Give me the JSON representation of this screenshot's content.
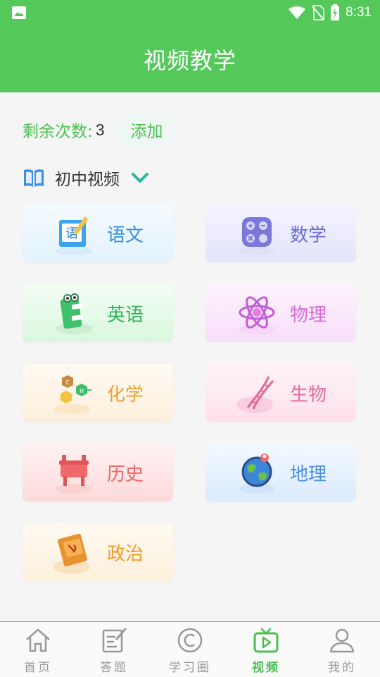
{
  "status_bar": {
    "time": "8:31"
  },
  "header": {
    "title": "视频教学"
  },
  "remaining": {
    "label": "剩余次数:",
    "count": "3",
    "add_label": "添加"
  },
  "level": {
    "label": "初中视频"
  },
  "subjects": [
    {
      "label": "语文",
      "color": "#3b8ee0"
    },
    {
      "label": "数学",
      "color": "#6b6fd6"
    },
    {
      "label": "英语",
      "color": "#2fb35a"
    },
    {
      "label": "物理",
      "color": "#d66ad6"
    },
    {
      "label": "化学",
      "color": "#e8a030"
    },
    {
      "label": "生物",
      "color": "#e96aa0"
    },
    {
      "label": "历史",
      "color": "#ef6767"
    },
    {
      "label": "地理",
      "color": "#4b8fe0"
    },
    {
      "label": "政治",
      "color": "#ec9a2a"
    }
  ],
  "tabs": [
    {
      "label": "首页",
      "icon": "home-icon",
      "active": false
    },
    {
      "label": "答题",
      "icon": "edit-icon",
      "active": false
    },
    {
      "label": "学习圈",
      "icon": "copyright-icon",
      "active": false
    },
    {
      "label": "视频",
      "icon": "tv-play-icon",
      "active": true
    },
    {
      "label": "我的",
      "icon": "user-icon",
      "active": false
    }
  ],
  "colors": {
    "brand": "#55c85a",
    "accent_text": "#4cbf52"
  }
}
